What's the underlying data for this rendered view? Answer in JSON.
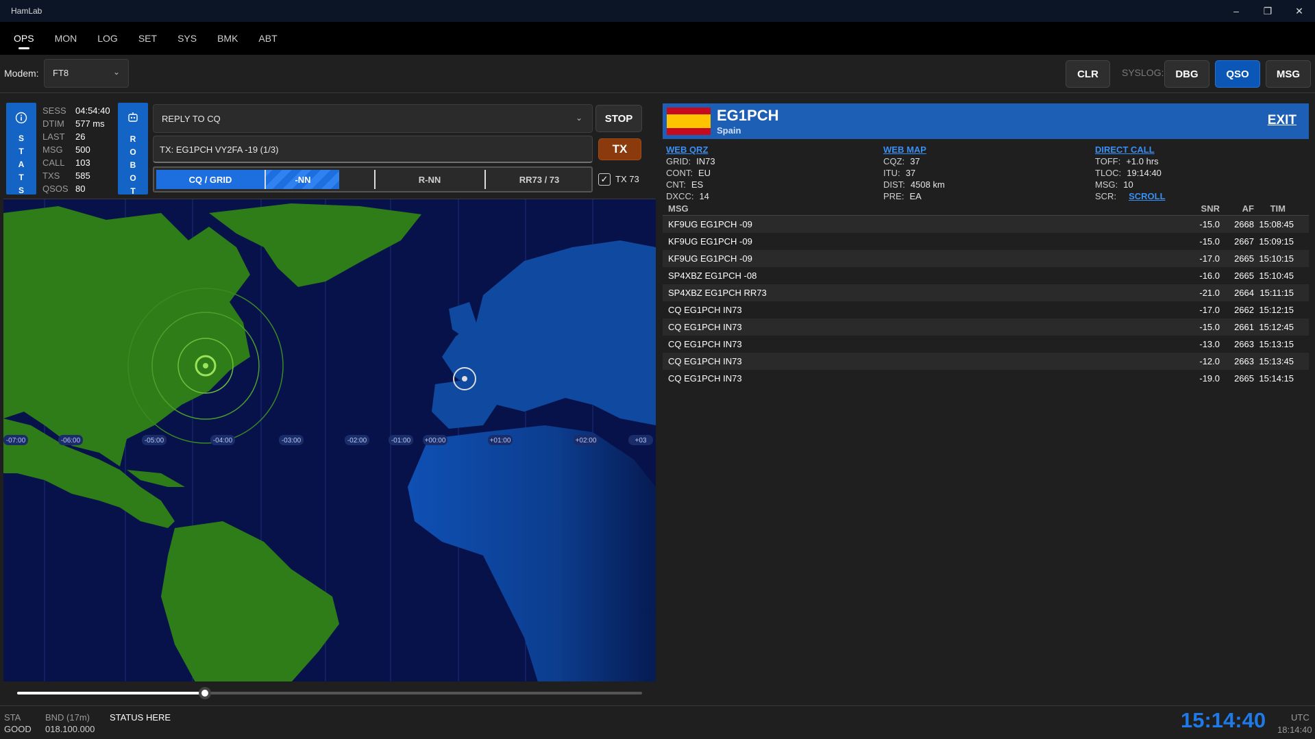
{
  "window": {
    "title": "HamLab",
    "minimize": "–",
    "restore": "❐",
    "close": "✕"
  },
  "tabs": [
    "OPS",
    "MON",
    "LOG",
    "SET",
    "SYS",
    "BMK",
    "ABT"
  ],
  "modem": {
    "label": "Modem:",
    "value": "FT8"
  },
  "toolbar": {
    "clr": "CLR",
    "syslog_label": "SYSLOG:",
    "dbg": "DBG",
    "qso": "QSO",
    "msg": "MSG"
  },
  "stats": {
    "label": "STATS",
    "rows": [
      {
        "k": "SESS",
        "v": "04:54:40"
      },
      {
        "k": "DTIM",
        "v": "577 ms"
      },
      {
        "k": "LAST",
        "v": "26"
      },
      {
        "k": "MSG",
        "v": "500"
      },
      {
        "k": "CALL",
        "v": "103"
      },
      {
        "k": "TXS",
        "v": "585"
      },
      {
        "k": "QSOS",
        "v": "80"
      }
    ]
  },
  "robot": {
    "label": "ROBOT"
  },
  "reply": {
    "value": "REPLY TO CQ",
    "stop": "STOP",
    "tx": "TX"
  },
  "tx_line": "TX: EG1PCH VY2FA -19 (1/3)",
  "sequence": {
    "steps": [
      "CQ / GRID",
      "-NN",
      "R-NN",
      "RR73 / 73"
    ],
    "progress": 0.42,
    "tx73_checked": true,
    "tx73_label": "TX 73"
  },
  "map": {
    "tz_labels": [
      "-07:00",
      "-06:00",
      "-05:00",
      "-04:00",
      "-03:00",
      "-02:00",
      "-01:00",
      "+00:00",
      "+01:00",
      "+02:00",
      "+03"
    ],
    "zoom_fraction": 0.3
  },
  "contact": {
    "call": "EG1PCH",
    "country": "Spain",
    "exit": "EXIT",
    "col1": {
      "link": "WEB QRZ",
      "rows": [
        {
          "k": "GRID:",
          "v": "IN73"
        },
        {
          "k": "CONT:",
          "v": "EU"
        },
        {
          "k": "CNT:",
          "v": "ES"
        },
        {
          "k": "DXCC:",
          "v": "14"
        }
      ]
    },
    "col2": {
      "link": "WEB MAP",
      "rows": [
        {
          "k": "CQZ:",
          "v": "37"
        },
        {
          "k": "ITU:",
          "v": "37"
        },
        {
          "k": "DIST:",
          "v": "4508 km"
        },
        {
          "k": "PRE:",
          "v": "EA"
        }
      ]
    },
    "col3": {
      "link": "DIRECT CALL",
      "rows": [
        {
          "k": "TOFF:",
          "v": "+1.0 hrs"
        },
        {
          "k": "TLOC:",
          "v": "19:14:40"
        },
        {
          "k": "MSG:",
          "v": "10"
        },
        {
          "k": "SCR:",
          "v": "SCROLL"
        }
      ]
    }
  },
  "messages": {
    "headers": [
      "MSG",
      "SNR",
      "AF",
      "TIM"
    ],
    "rows": [
      [
        "KF9UG EG1PCH -09",
        "-15.0",
        "2668",
        "15:08:45"
      ],
      [
        "KF9UG EG1PCH -09",
        "-15.0",
        "2667",
        "15:09:15"
      ],
      [
        "KF9UG EG1PCH -09",
        "-17.0",
        "2665",
        "15:10:15"
      ],
      [
        "SP4XBZ EG1PCH -08",
        "-16.0",
        "2665",
        "15:10:45"
      ],
      [
        "SP4XBZ EG1PCH RR73",
        "-21.0",
        "2664",
        "15:11:15"
      ],
      [
        "CQ EG1PCH IN73",
        "-17.0",
        "2662",
        "15:12:15"
      ],
      [
        "CQ EG1PCH IN73",
        "-15.0",
        "2661",
        "15:12:45"
      ],
      [
        "CQ EG1PCH IN73",
        "-13.0",
        "2663",
        "15:13:15"
      ],
      [
        "CQ EG1PCH IN73",
        "-12.0",
        "2663",
        "15:13:45"
      ],
      [
        "CQ EG1PCH IN73",
        "-19.0",
        "2665",
        "15:14:15"
      ]
    ]
  },
  "status": {
    "sta_label": "STA",
    "sta_value": "GOOD",
    "bnd_label": "BND (17m)",
    "bnd_value": "018.100.000",
    "text": "STATUS HERE",
    "utc_time": "15:14:40",
    "utc_label": "UTC",
    "local_time": "18:14:40"
  },
  "colors": {
    "accent": "#1364c4",
    "tx": "#8a3a0c",
    "land_green": "#2e7d18",
    "land_blue": "#0f4aa0",
    "ocean": "#08124a"
  }
}
